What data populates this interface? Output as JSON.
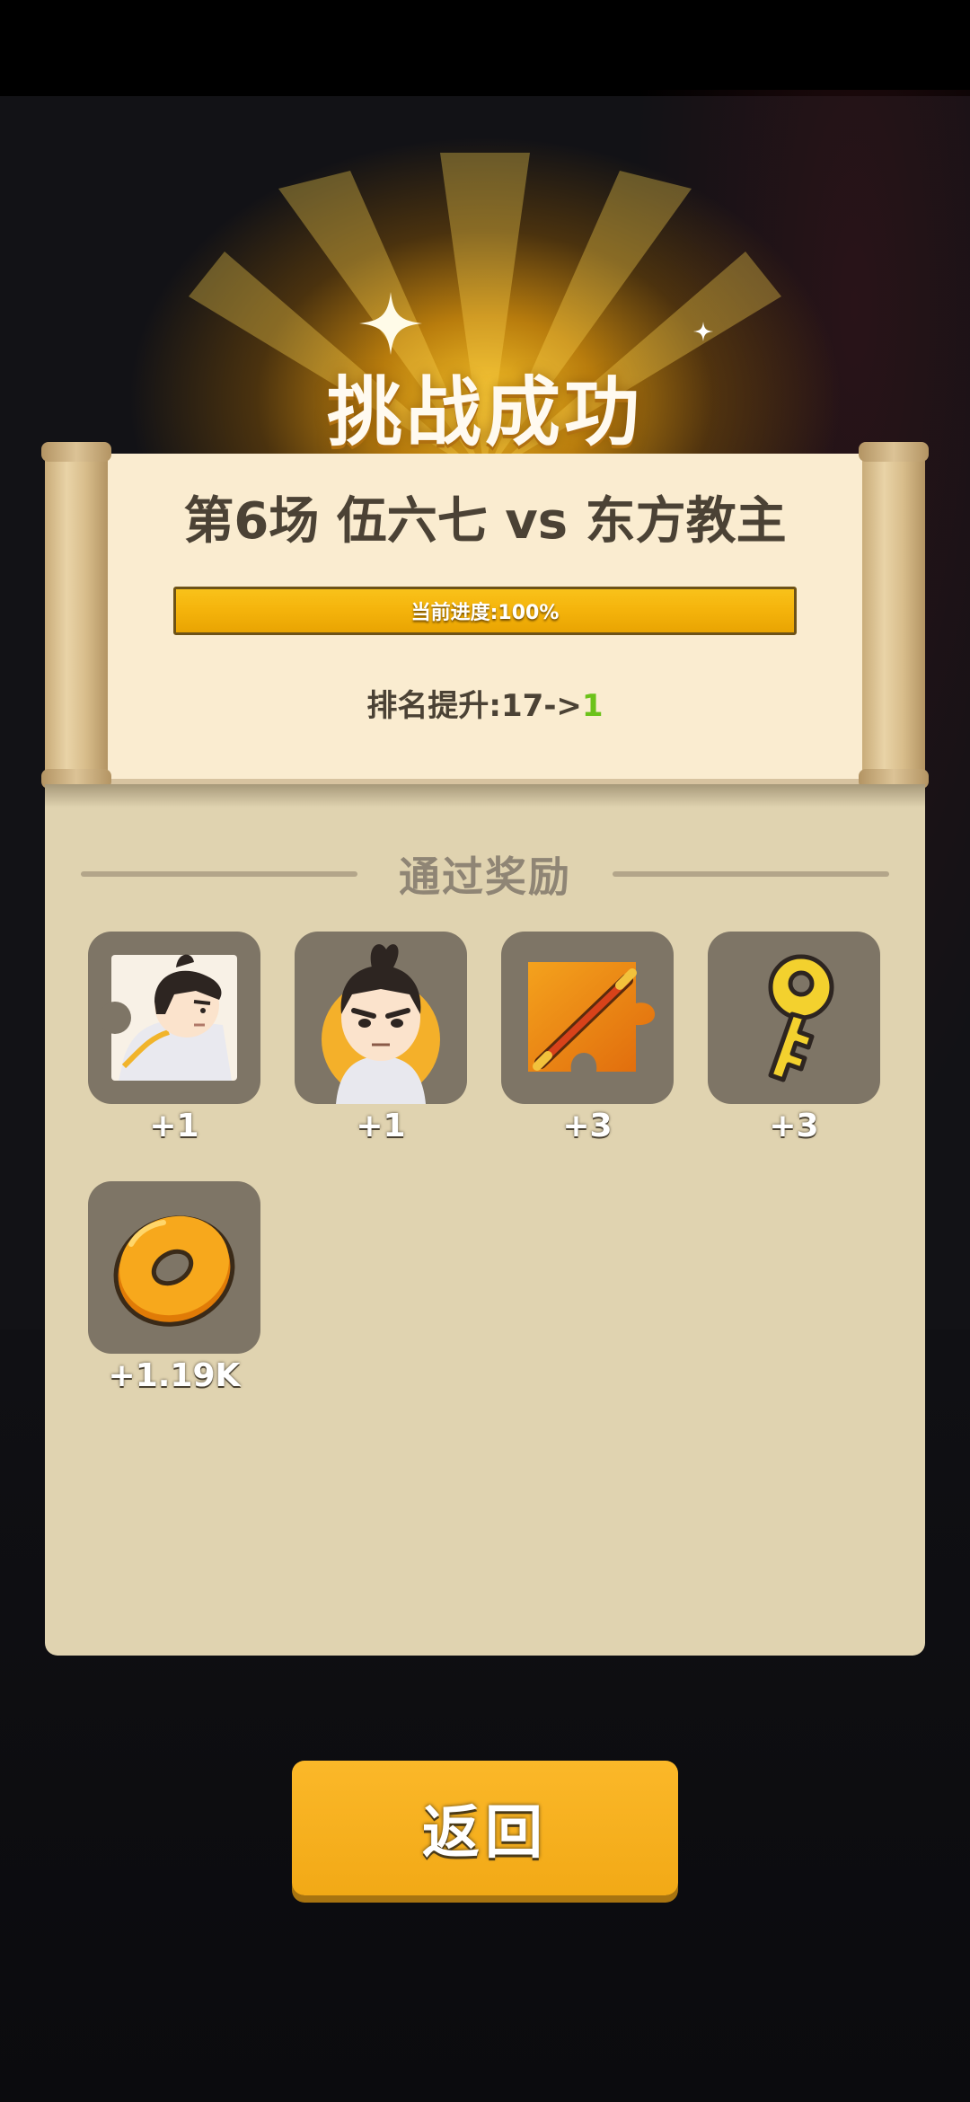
{
  "header": {
    "title": "挑战成功"
  },
  "match": {
    "title": "第6场 伍六七 vs 东方教主",
    "progress_text": "当前进度:100%",
    "progress_fraction": 1.0,
    "rank_prefix": "排名提升:17->",
    "rank_new": "1"
  },
  "rewards": {
    "heading": "通过奖励",
    "items": [
      {
        "icon": "character-portrait-fragment-icon",
        "count": "+1"
      },
      {
        "icon": "character-avatar-icon",
        "count": "+1"
      },
      {
        "icon": "weapon-puzzle-fragment-icon",
        "count": "+3"
      },
      {
        "icon": "golden-key-icon",
        "count": "+3"
      },
      {
        "icon": "gold-coin-icon",
        "count": "+1.19K"
      }
    ]
  },
  "footer": {
    "back_label": "返回"
  },
  "colors": {
    "accent_orange": "#f4ab1b",
    "rank_up_green": "#6cc21a",
    "paper": "#faecd0",
    "panel": "#e0d3b0",
    "tile": "#7e7566"
  }
}
